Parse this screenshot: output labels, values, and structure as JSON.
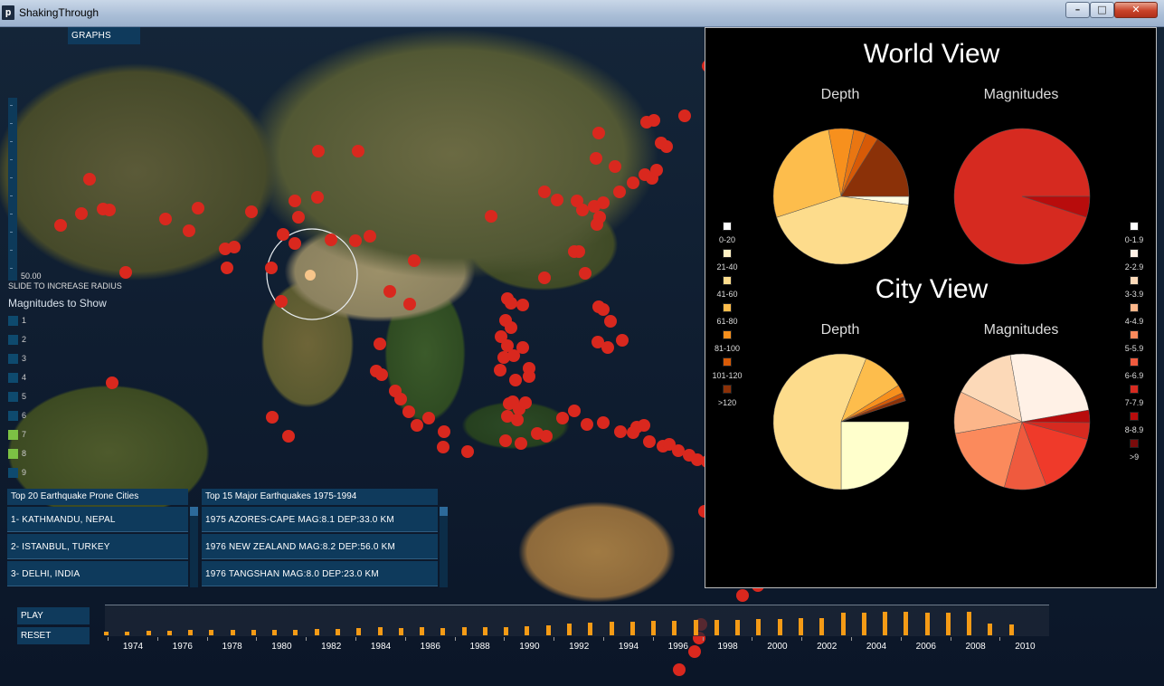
{
  "window": {
    "title": "ShakingThrough",
    "app_icon": "p",
    "controls": {
      "minimize": "–",
      "maximize": "□",
      "close": "✕"
    }
  },
  "graphs_tab": "GRAPHS",
  "radius": {
    "value": "50.00",
    "label": "SLIDE TO INCREASE RADIUS",
    "fraction": 0.0
  },
  "magnitudes": {
    "header": "Magnitudes to Show",
    "items": [
      {
        "label": "1",
        "color": "#0e4a6e"
      },
      {
        "label": "2",
        "color": "#0e4a6e"
      },
      {
        "label": "3",
        "color": "#0e4a6e"
      },
      {
        "label": "4",
        "color": "#0e4a6e"
      },
      {
        "label": "5",
        "color": "#0e4a6e"
      },
      {
        "label": "6",
        "color": "#0e4a6e"
      },
      {
        "label": "7",
        "color": "#7cc144"
      },
      {
        "label": "8",
        "color": "#7cc144"
      },
      {
        "label": "9",
        "color": "#0e4a6e"
      }
    ]
  },
  "cities": {
    "header": "Top 20 Earthquake Prone Cities",
    "rows": [
      "1- KATHMANDU,  NEPAL",
      "2- ISTANBUL,  TURKEY",
      "3- DELHI,  INDIA"
    ]
  },
  "major_quakes": {
    "header": "Top 15 Major Earthquakes 1975-1994",
    "rows": [
      "1975  AZORES-CAPE  MAG:8.1 DEP:33.0 KM",
      "1976  NEW ZEALAND  MAG:8.2 DEP:56.0 KM",
      "1976  TANGSHAN   MAG:8.0 DEP:23.0 KM"
    ]
  },
  "controls": {
    "play": "PLAY",
    "reset": "RESET"
  },
  "timeline": {
    "years": [
      "1974",
      "1976",
      "1978",
      "1980",
      "1982",
      "1984",
      "1986",
      "1988",
      "1990",
      "1992",
      "1994",
      "1996",
      "1998",
      "2000",
      "2002",
      "2004",
      "2006",
      "2008",
      "2010"
    ],
    "bar_values": [
      0.12,
      0.15,
      0.17,
      0.18,
      0.2,
      0.2,
      0.21,
      0.2,
      0.2,
      0.21,
      0.22,
      0.23,
      0.26,
      0.3,
      0.28,
      0.3,
      0.28,
      0.3,
      0.3,
      0.3,
      0.34,
      0.38,
      0.42,
      0.46,
      0.5,
      0.5,
      0.52,
      0.52,
      0.56,
      0.56,
      0.56,
      0.6,
      0.6,
      0.62,
      0.64,
      0.82,
      0.84,
      0.86,
      0.86,
      0.84,
      0.84,
      0.86,
      0.42,
      0.4
    ],
    "bar_color": "#f59b16"
  },
  "panel": {
    "world_title": "World View",
    "city_title": "City View",
    "depth_label": "Depth",
    "magnitudes_label": "Magnitudes",
    "depth_legend": [
      {
        "label": "0-20",
        "color": "#ffffff"
      },
      {
        "label": "21-40",
        "color": "#fff1c4"
      },
      {
        "label": "41-60",
        "color": "#fddc8c"
      },
      {
        "label": "61-80",
        "color": "#fdbd4c"
      },
      {
        "label": "81-100",
        "color": "#f7901d"
      },
      {
        "label": "101-120",
        "color": "#d75a07"
      },
      {
        "label": ">120",
        "color": "#8b3108"
      }
    ],
    "mag_legend": [
      {
        "label": "0-1.9",
        "color": "#ffffff"
      },
      {
        "label": "2-2.9",
        "color": "#fff1e6"
      },
      {
        "label": "3-3.9",
        "color": "#fcd9b8"
      },
      {
        "label": "4-4.9",
        "color": "#fcb68a"
      },
      {
        "label": "5-5.9",
        "color": "#fb8a5c"
      },
      {
        "label": "6-6.9",
        "color": "#ef5a3e"
      },
      {
        "label": "7-7.9",
        "color": "#d62a20"
      },
      {
        "label": "8-8.9",
        "color": "#b80c0c"
      },
      {
        "label": ">9",
        "color": "#7a0b0b"
      }
    ],
    "world_depth_pie": [
      {
        "value": 0.02,
        "color": "#fffbe0"
      },
      {
        "value": 0.43,
        "color": "#fddc8c"
      },
      {
        "value": 0.27,
        "color": "#fdbd4c"
      },
      {
        "value": 0.06,
        "color": "#f7901d"
      },
      {
        "value": 0.03,
        "color": "#e97612"
      },
      {
        "value": 0.03,
        "color": "#d75a07"
      },
      {
        "value": 0.16,
        "color": "#8b3108"
      }
    ],
    "world_mag_pie": [
      {
        "value": 0.95,
        "color": "#d62a20"
      },
      {
        "value": 0.05,
        "color": "#b80c0c"
      }
    ],
    "city_depth_pie": [
      {
        "value": 0.25,
        "color": "#ffffcc"
      },
      {
        "value": 0.56,
        "color": "#fddc8c"
      },
      {
        "value": 0.1,
        "color": "#fdbd4c"
      },
      {
        "value": 0.02,
        "color": "#f7901d"
      },
      {
        "value": 0.01,
        "color": "#d75a07"
      },
      {
        "value": 0.01,
        "color": "#8b3108"
      }
    ],
    "city_mag_pie": [
      {
        "value": 0.03,
        "color": "#b80c0c"
      },
      {
        "value": 0.04,
        "color": "#d62a20"
      },
      {
        "value": 0.15,
        "color": "#ef3a2a"
      },
      {
        "value": 0.1,
        "color": "#ef5a3e"
      },
      {
        "value": 0.18,
        "color": "#fb8a5c"
      },
      {
        "value": 0.1,
        "color": "#fcb68a"
      },
      {
        "value": 0.15,
        "color": "#fcd9b8"
      },
      {
        "value": 0.25,
        "color": "#fff1e6"
      }
    ]
  },
  "marker_color": "#d9281e"
}
